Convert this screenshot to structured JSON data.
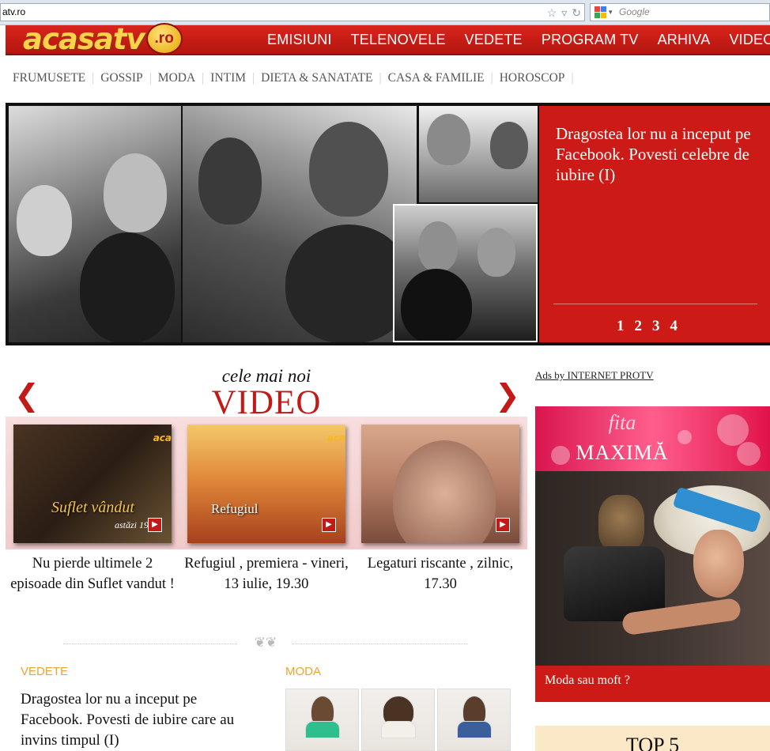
{
  "browser": {
    "url": "atv.ro",
    "search_placeholder": "Google"
  },
  "header": {
    "logo_text": "acasatv",
    "logo_suffix": ".ro",
    "nav": [
      "EMISIUNI",
      "TELENOVELE",
      "VEDETE",
      "PROGRAM TV",
      "ARHIVA",
      "VIDEO"
    ]
  },
  "categories": [
    "FRUMUSETE",
    "GOSSIP",
    "MODA",
    "INTIM",
    "DIETA & SANATATE",
    "CASA & FAMILIE",
    "HOROSCOP"
  ],
  "hero": {
    "title": "Dragostea lor nu a inceput pe Facebook. Povesti celebre de iubire (I)",
    "pages": [
      "1",
      "2",
      "3",
      "4"
    ]
  },
  "video": {
    "kicker": "cele mai noi",
    "title": "VIDEO",
    "items": [
      {
        "thumb_title": "Suflet vândut",
        "thumb_sub": "astăzi 19:30",
        "caption": "Nu pierde ultimele 2 episoade din Suflet vandut !"
      },
      {
        "thumb_title": "Refugiul",
        "thumb_sub": "",
        "caption": "Refugiul , premiera - vineri, 13 iulie, 19.30"
      },
      {
        "thumb_title": "",
        "thumb_sub": "",
        "caption": "Legaturi riscante , zilnic, 17.30"
      }
    ],
    "thumb_brand": "aca"
  },
  "sections": {
    "vedete_label": "VEDETE",
    "vedete_article": "Dragostea lor nu a inceput pe Facebook. Povesti de iubire care au invins timpul (I)",
    "moda_label": "MODA"
  },
  "sidebar": {
    "ads_link": "Ads by INTERNET PROTV",
    "promo_kicker": "fita",
    "promo_title": "MAXIMĂ",
    "promo_caption": "Moda sau moft ?",
    "top5_title": "TOP 5"
  },
  "colors": {
    "brand_red": "#cc1b16",
    "accent_orange": "#f0a232",
    "logo_yellow": "#ffd24a"
  },
  "icons": {
    "bookmark": "star-icon",
    "refresh": "refresh-icon",
    "prev": "chevron-left-icon",
    "next": "chevron-right-icon",
    "play": "play-icon"
  }
}
